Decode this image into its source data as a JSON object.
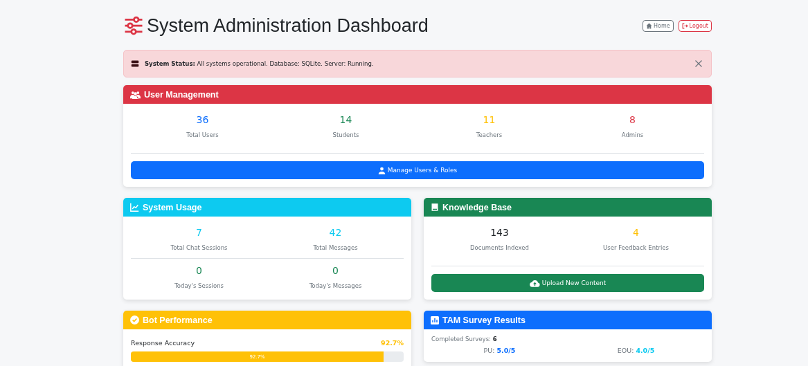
{
  "header": {
    "title": "System Administration Dashboard",
    "buttons": [
      {
        "label": "Home",
        "kind": "secondary"
      },
      {
        "label": "Logout",
        "kind": "danger"
      }
    ]
  },
  "alert": {
    "label": "System Status:",
    "text": "All systems operational. Database: SQLite. Server: Running.",
    "dismissible": true
  },
  "cards": [
    {
      "title": "User Management",
      "color": "#dc3545",
      "wide": true,
      "stat_rows": [
        [
          {
            "value": "36",
            "label": "Total Users",
            "color": "#0d6efd"
          },
          {
            "value": "14",
            "label": "Students",
            "color": "#198754"
          },
          {
            "value": "11",
            "label": "Teachers",
            "color": "#ffc107"
          },
          {
            "value": "8",
            "label": "Admins",
            "color": "#dc3545"
          }
        ]
      ],
      "button": {
        "label": "Manage Users & Roles",
        "color": "#0d6efd"
      }
    },
    {
      "title": "System Usage",
      "color": "#0dcaf0",
      "wide": false,
      "stat_rows": [
        [
          {
            "value": "7",
            "label": "Total Chat Sessions",
            "color": "#0dcaf0"
          },
          {
            "value": "42",
            "label": "Total Messages",
            "color": "#0dcaf0"
          }
        ],
        [
          {
            "value": "0",
            "label": "Today's Sessions",
            "color": "#198754"
          },
          {
            "value": "0",
            "label": "Today's Messages",
            "color": "#198754"
          }
        ]
      ]
    },
    {
      "title": "Knowledge Base",
      "color": "#198754",
      "wide": false,
      "stat_rows": [
        [
          {
            "value": "143",
            "label": "Documents Indexed",
            "color": "#212529"
          },
          {
            "value": "4",
            "label": "User Feedback Entries",
            "color": "#ffc107"
          }
        ]
      ],
      "button": {
        "label": "Upload New Content",
        "color": "#198754"
      }
    },
    {
      "title": "Bot Performance",
      "color": "#ffc107",
      "wide": false,
      "metrics": [
        {
          "label": "Response Accuracy",
          "reading": "92.7%",
          "level": 0.927,
          "bar_label": "92.7%"
        }
      ]
    },
    {
      "title": "TAM Survey Results",
      "color": "#0d6efd",
      "wide": false,
      "summary": {
        "label": "Completed Surveys:",
        "value": "6"
      },
      "scores": [
        {
          "label": "PU:",
          "value": "5.0/5",
          "color": "#0d6efd"
        },
        {
          "label": "EOU:",
          "value": "4.0/5",
          "color": "#0dcaf0"
        }
      ]
    }
  ]
}
